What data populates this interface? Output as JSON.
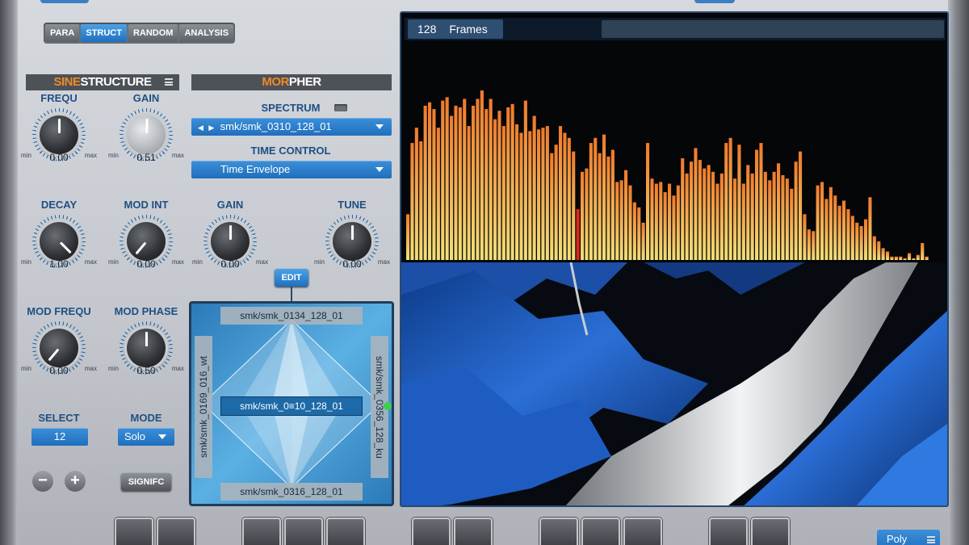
{
  "tabs": [
    {
      "label": "PARA",
      "active": false
    },
    {
      "label": "STRUCT",
      "active": true
    },
    {
      "label": "RANDOM",
      "active": false
    },
    {
      "label": "ANALYSIS",
      "active": false
    }
  ],
  "sine_structure": {
    "title_accent": "SINE",
    "title_rest": "STRUCTURE",
    "knobs": [
      {
        "label": "FREQU",
        "value": "0.00",
        "min": "min",
        "max": "max"
      },
      {
        "label": "GAIN",
        "value": "0.51",
        "min": "min",
        "max": "max"
      },
      {
        "label": "DECAY",
        "value": "1.00",
        "min": "min",
        "max": "max"
      },
      {
        "label": "MOD INT",
        "value": "0.00",
        "min": "min",
        "max": "max"
      },
      {
        "label": "MOD FREQU",
        "value": "0.00",
        "min": "min",
        "max": "max"
      },
      {
        "label": "MOD PHASE",
        "value": "0.50",
        "min": "min",
        "max": "max"
      }
    ],
    "select_label": "SELECT",
    "select_value": "12",
    "mode_label": "MODE",
    "mode_value": "Solo",
    "minus_label": "−",
    "plus_label": "+",
    "signifc_label": "SIGNIFC"
  },
  "morpher": {
    "title_accent": "MOR",
    "title_rest": "PHER",
    "spectrum_label": "SPECTRUM",
    "spectrum_arrows": "◀ ▶",
    "spectrum_value": "smk/smk_0310_128_01",
    "time_control_label": "TIME CONTROL",
    "time_control_value": "Time Envelope",
    "knobs": [
      {
        "label": "GAIN",
        "value": "0.00",
        "min": "min",
        "max": "max"
      },
      {
        "label": "TUNE",
        "value": "0.00",
        "min": "min",
        "max": "max"
      }
    ],
    "edit_label": "EDIT",
    "pad": {
      "top": "smk/smk_0134_128_01",
      "left": "smk/smk_0169_016_wt",
      "center": "smk/smk_0≡10_128_01",
      "right": "smk/smk_0356_128_ku",
      "bottom": "smk/smk_0316_128_01"
    }
  },
  "display": {
    "frames_count": "128",
    "frames_label": "Frames"
  },
  "spectrum_bars": [
    0.27,
    0.69,
    0.78,
    0.7,
    0.91,
    0.93,
    0.89,
    0.78,
    0.94,
    0.96,
    0.85,
    0.91,
    0.9,
    0.95,
    0.79,
    0.91,
    0.95,
    1.0,
    0.89,
    0.95,
    0.83,
    0.88,
    0.79,
    0.9,
    0.92,
    0.8,
    0.75,
    0.94,
    0.76,
    0.85,
    0.77,
    0.78,
    0.79,
    0.63,
    0.68,
    0.79,
    0.75,
    0.72,
    0.64,
    0.3,
    0.52,
    0.54,
    0.69,
    0.72,
    0.63,
    0.74,
    0.61,
    0.65,
    0.46,
    0.47,
    0.53,
    0.44,
    0.34,
    0.31,
    0.22,
    0.69,
    0.48,
    0.45,
    0.46,
    0.4,
    0.45,
    0.38,
    0.44,
    0.6,
    0.51,
    0.58,
    0.66,
    0.59,
    0.54,
    0.56,
    0.52,
    0.45,
    0.51,
    0.69,
    0.72,
    0.48,
    0.68,
    0.45,
    0.56,
    0.51,
    0.65,
    0.69,
    0.52,
    0.47,
    0.52,
    0.57,
    0.5,
    0.48,
    0.42,
    0.58,
    0.64,
    0.27,
    0.18,
    0.17,
    0.44,
    0.46,
    0.36,
    0.43,
    0.38,
    0.32,
    0.35,
    0.3,
    0.26,
    0.22,
    0.2,
    0.24,
    0.37,
    0.14,
    0.11,
    0.07,
    0.05,
    0.02,
    0.02,
    0.02,
    0.01,
    0.04,
    0.01,
    0.03,
    0.1,
    0.02
  ],
  "spectrum_marker_index": 39,
  "colors": {
    "bar_top": "#f07a2a",
    "bar_bottom": "#f2e07a",
    "marker": "#d9281e",
    "accent": "#1f6fbd"
  },
  "voice_mode": "Poly"
}
